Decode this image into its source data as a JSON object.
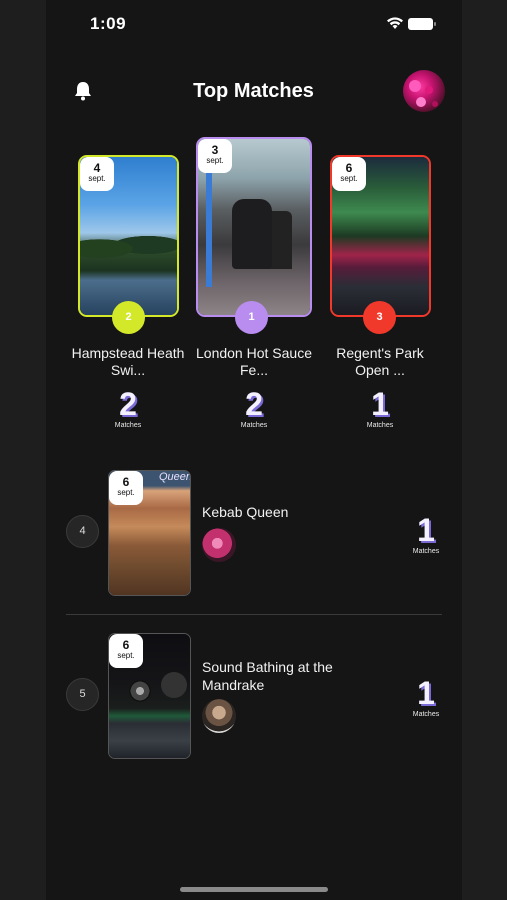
{
  "status": {
    "time": "1:09"
  },
  "header": {
    "title": "Top Matches"
  },
  "top3": [
    {
      "day": "4",
      "month": "sept.",
      "rank": "2",
      "name": "Hampstead Heath Swi...",
      "count": "2",
      "label": "Matches",
      "accent": "#d4e82a",
      "photo": "hampstead-pond"
    },
    {
      "day": "3",
      "month": "sept.",
      "rank": "1",
      "name": "London Hot Sauce Fe...",
      "count": "2",
      "label": "Matches",
      "accent": "#b98cf0",
      "photo": "hot-sauce-festival"
    },
    {
      "day": "6",
      "month": "sept.",
      "rank": "3",
      "name": "Regent's Park Open ...",
      "count": "1",
      "label": "Matches",
      "accent": "#f0392b",
      "photo": "open-air-theatre"
    }
  ],
  "list": [
    {
      "rank": "4",
      "day": "6",
      "month": "sept.",
      "title": "Kebab Queen",
      "count": "1",
      "label": "Matches",
      "photo": "kebab-queen"
    },
    {
      "rank": "5",
      "day": "6",
      "month": "sept.",
      "title": "Sound Bathing at the Mandrake",
      "count": "1",
      "label": "Matches",
      "photo": "sound-bathing"
    }
  ],
  "colors": {
    "background": "#151515",
    "rank2": "#d4e82a",
    "rank1": "#b98cf0",
    "rank3": "#f0392b",
    "number_shadow": "#7a6ad6"
  }
}
